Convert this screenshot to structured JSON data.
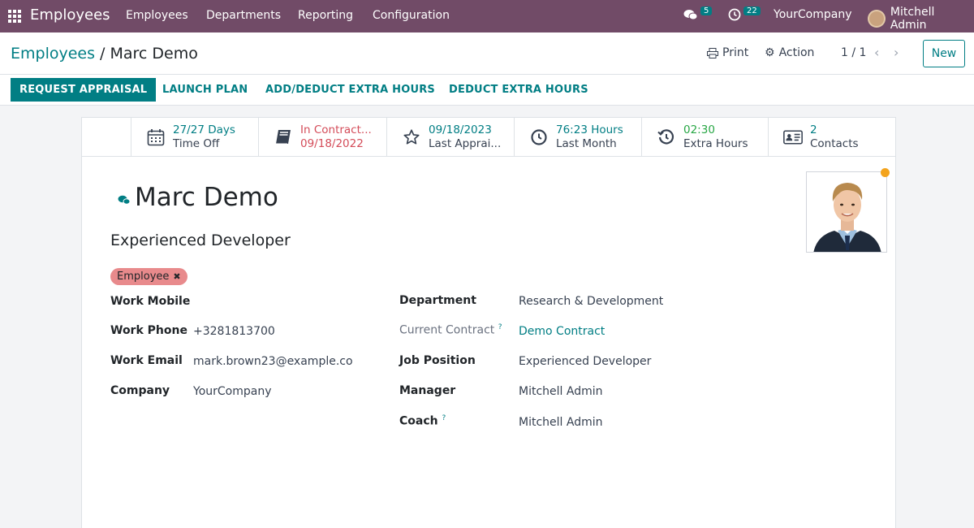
{
  "navbar": {
    "app_name": "Employees",
    "menu": [
      "Employees",
      "Departments",
      "Reporting",
      "Configuration"
    ],
    "messages_count": "5",
    "activities_count": "22",
    "company": "YourCompany",
    "user": "Mitchell Admin"
  },
  "control": {
    "breadcrumb_parent": "Employees",
    "breadcrumb_sep": "/",
    "breadcrumb_current": "Marc Demo",
    "print_label": "Print",
    "action_label": "Action",
    "pager": "1 / 1",
    "new_label": "New"
  },
  "actions": [
    "REQUEST APPRAISAL",
    "LAUNCH PLAN",
    "ADD/DEDUCT EXTRA HOURS",
    "DEDUCT EXTRA HOURS"
  ],
  "smart_buttons": [
    {
      "value": "27/27 Days",
      "label": "Time Off",
      "icon": "calendar-icon"
    },
    {
      "value": "In Contract...",
      "label": "09/18/2022",
      "icon": "book-icon"
    },
    {
      "value": "09/18/2023",
      "label": "Last Apprai...",
      "icon": "star-icon"
    },
    {
      "value": "76:23 Hours",
      "label": "Last Month",
      "icon": "clock-icon"
    },
    {
      "value": "02:30",
      "label": "Extra Hours",
      "icon": "history-icon"
    },
    {
      "value": "2",
      "label": "Contacts",
      "icon": "id-card-icon"
    }
  ],
  "employee": {
    "name": "Marc Demo",
    "job_title": "Experienced Developer",
    "tag": "Employee",
    "status_color": "#f3a31c"
  },
  "fields_left": [
    {
      "label": "Work Mobile",
      "value": ""
    },
    {
      "label": "Work Phone",
      "value": "+3281813700"
    },
    {
      "label": "Work Email",
      "value": "mark.brown23@example.com"
    },
    {
      "label": "Company",
      "value": "YourCompany"
    }
  ],
  "fields_right": [
    {
      "label": "Department",
      "value": "Research & Development"
    },
    {
      "label": "Current Contract",
      "value": "Demo Contract"
    },
    {
      "label": "Job Position",
      "value": "Experienced Developer"
    },
    {
      "label": "Manager",
      "value": "Mitchell Admin"
    },
    {
      "label": "Coach",
      "value": "Mitchell Admin"
    }
  ],
  "help_mark": "?",
  "colors": {
    "brand": "#714b67",
    "accent": "#017e84",
    "danger": "#d44c59",
    "success": "#28a745",
    "tag": "#e88a8c"
  }
}
